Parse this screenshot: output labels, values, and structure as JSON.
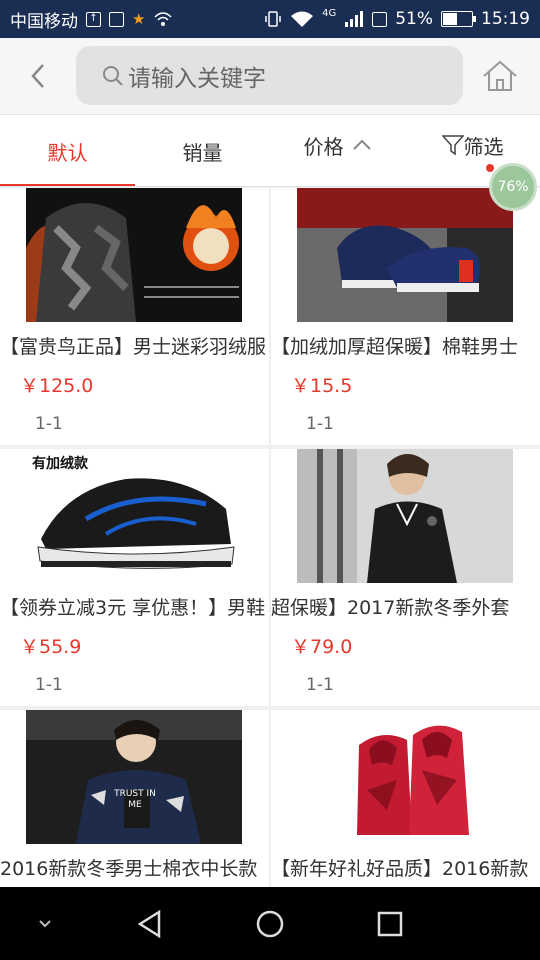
{
  "status_bar": {
    "carrier": "中国移动",
    "network": "4G",
    "battery": "51%",
    "battery_level": 0.51,
    "time": "15:19"
  },
  "header": {
    "search_placeholder": "请输入关键字"
  },
  "tabs": [
    {
      "label": "默认",
      "active": true
    },
    {
      "label": "销量",
      "active": false
    },
    {
      "label": "价格",
      "active": false
    },
    {
      "label": "筛选",
      "active": false
    }
  ],
  "badge": "76%",
  "products": [
    {
      "title": "【富贵鸟正品】男士迷彩羽绒服",
      "price": "￥125.0",
      "meta": "1-1"
    },
    {
      "title": "【加绒加厚超保暖】棉鞋男士",
      "price": "￥15.5",
      "meta": "1-1"
    },
    {
      "title": "【领券立减3元 享优惠！】男鞋",
      "price": "￥55.9",
      "meta": "1-1",
      "img_label": "有加绒款"
    },
    {
      "title": "超保暖】2017新款冬季外套",
      "price": "￥79.0",
      "meta": "1-1"
    },
    {
      "title": "2016新款冬季男士棉衣中长款",
      "price": "",
      "meta": ""
    },
    {
      "title": "【新年好礼好品质】2016新款",
      "price": "",
      "meta": ""
    }
  ],
  "product_image_text": {
    "trust_me": "TRUST IN ME"
  },
  "colors": {
    "accent": "#e8372b",
    "status_bar": "#1a2d52"
  }
}
